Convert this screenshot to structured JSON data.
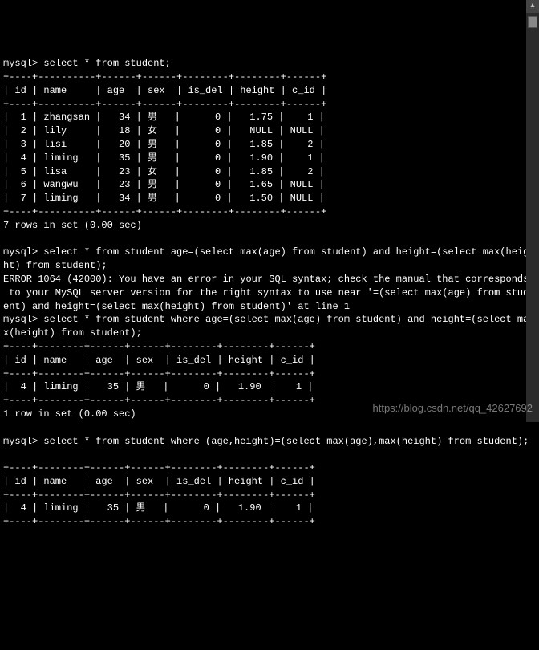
{
  "prompt1": "mysql> select * from student;",
  "table1": {
    "border": "+----+----------+------+------+--------+--------+------+",
    "header": "| id | name     | age  | sex  | is_del | height | c_id |",
    "rows": [
      "|  1 | zhangsan |   34 | 男   |      0 |   1.75 |    1 |",
      "|  2 | lily     |   18 | 女   |      0 |   NULL | NULL |",
      "|  3 | lisi     |   20 | 男   |      0 |   1.85 |    2 |",
      "|  4 | liming   |   35 | 男   |      0 |   1.90 |    1 |",
      "|  5 | lisa     |   23 | 女   |      0 |   1.85 |    2 |",
      "|  6 | wangwu   |   23 | 男   |      0 |   1.65 | NULL |",
      "|  7 | liming   |   34 | 男   |      0 |   1.50 | NULL |"
    ],
    "footer": "7 rows in set (0.00 sec)"
  },
  "prompt2_line1": "mysql> select * from student age=(select max(age) from student) and height=(select max(heig",
  "prompt2_line2": "ht) from student);",
  "error_line1": "ERROR 1064 (42000): You have an error in your SQL syntax; check the manual that corresponds",
  "error_line2": " to your MySQL server version for the right syntax to use near '=(select max(age) from stud",
  "error_line3": "ent) and height=(select max(height) from student)' at line 1",
  "prompt3_line1": "mysql> select * from student where age=(select max(age) from student) and height=(select ma",
  "prompt3_line2": "x(height) from student);",
  "table2": {
    "border": "+----+--------+------+------+--------+--------+------+",
    "header": "| id | name   | age  | sex  | is_del | height | c_id |",
    "row": "|  4 | liming |   35 | 男   |      0 |   1.90 |    1 |",
    "footer": "1 row in set (0.00 sec)"
  },
  "prompt4": "mysql> select * from student where (age,height)=(select max(age),max(height) from student);",
  "table3": {
    "border": "+----+--------+------+------+--------+--------+------+",
    "header": "| id | name   | age  | sex  | is_del | height | c_id |",
    "row": "|  4 | liming |   35 | 男   |      0 |   1.90 |    1 |"
  },
  "watermark": "https://blog.csdn.net/qq_42627692",
  "scroll_arrow": "▴"
}
